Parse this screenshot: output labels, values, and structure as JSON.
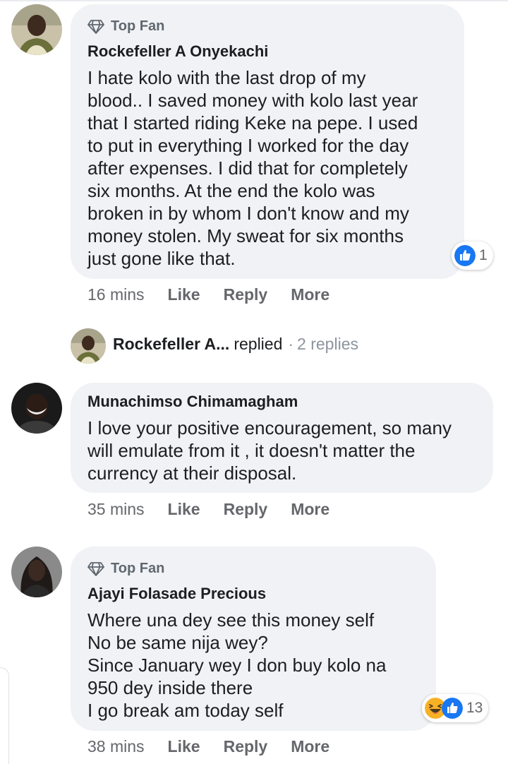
{
  "comments": [
    {
      "badge": "Top Fan",
      "author": "Rockefeller A Onyekachi",
      "lines": [
        "I hate kolo with the last drop of my",
        "blood.. I saved money with kolo last year",
        "that I started riding Keke na pepe. I used",
        "to put in everything I worked for the day",
        "after expenses. I did that for completely",
        "six months. At the end the kolo was",
        "broken in by whom I don't know and my",
        "money stolen. My sweat for six months",
        "just gone like that."
      ],
      "reaction_count": "1",
      "reaction_icons": [
        "like-icon"
      ],
      "time": "16 mins",
      "like_label": "Like",
      "reply_label": "Reply",
      "more_label": "More",
      "replies_summary": {
        "name": "Rockefeller A...",
        "verb": "replied",
        "separator": "·",
        "count": "2 replies"
      }
    },
    {
      "author": "Munachimso Chimamagham",
      "lines": [
        "I love your positive encouragement, so many",
        "will emulate from it , it doesn't matter the",
        "currency at their disposal."
      ],
      "time": "35 mins",
      "like_label": "Like",
      "reply_label": "Reply",
      "more_label": "More"
    },
    {
      "badge": "Top Fan",
      "author": "Ajayi Folasade Precious",
      "lines": [
        "Where una dey see this money self",
        "No be same nija wey?",
        "Since January wey I don buy kolo na",
        "950 dey inside there",
        "I go break am today self"
      ],
      "reaction_count": "13",
      "reaction_icons": [
        "haha-icon",
        "like-icon"
      ],
      "time": "38 mins",
      "like_label": "Like",
      "reply_label": "Reply",
      "more_label": "More"
    }
  ],
  "colors": {
    "bubble": "#f0f2f5",
    "like_blue": "#1877f2",
    "meta_gray": "#65676b",
    "haha_yellow": "#f7b125"
  }
}
